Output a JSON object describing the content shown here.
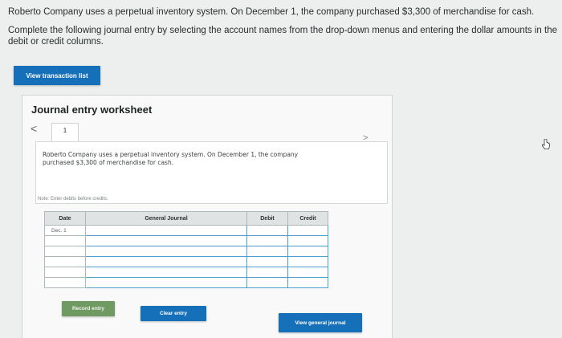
{
  "instructions": {
    "line1": "Roberto Company uses a perpetual inventory system. On December 1, the company purchased $3,300 of merchandise for cash.",
    "line2": "Complete the following journal entry by selecting the account names from the drop-down menus and entering the dollar amounts in the debit or credit columns."
  },
  "buttons": {
    "view_transaction_list": "View transaction list",
    "record_entry": "Record entry",
    "clear_entry": "Clear entry",
    "view_general_journal": "View general journal"
  },
  "worksheet": {
    "title": "Journal entry worksheet",
    "nav_prev": "<",
    "nav_next": ">",
    "tab": "1",
    "description": "Roberto Company uses a perpetual inventory system. On December 1, the company purchased $3,300 of merchandise for cash.",
    "note": "Note: Enter debits before credits."
  },
  "journal": {
    "headers": {
      "date": "Date",
      "account": "General Journal",
      "debit": "Debit",
      "credit": "Credit"
    },
    "rows": [
      {
        "date": "Dec. 1",
        "account": "",
        "debit": "",
        "credit": ""
      },
      {
        "date": "",
        "account": "",
        "debit": "",
        "credit": ""
      },
      {
        "date": "",
        "account": "",
        "debit": "",
        "credit": ""
      },
      {
        "date": "",
        "account": "",
        "debit": "",
        "credit": ""
      },
      {
        "date": "",
        "account": "",
        "debit": "",
        "credit": ""
      },
      {
        "date": "",
        "account": "",
        "debit": "",
        "credit": ""
      }
    ]
  },
  "colors": {
    "button_blue": "#1570b9",
    "button_green": "#6f9a62",
    "input_border": "#4d9fd0"
  }
}
